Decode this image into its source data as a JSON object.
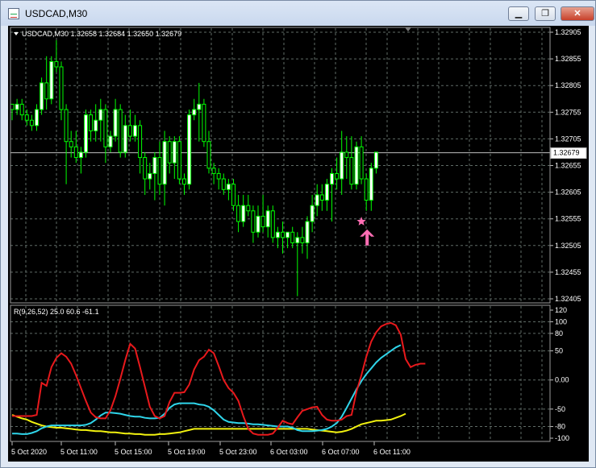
{
  "window": {
    "title": "USDCAD,M30",
    "minimize_glyph": "▁",
    "restore_glyph": "❐",
    "close_glyph": "✕"
  },
  "colors": {
    "background": "#000000",
    "grid": "#5f6b66",
    "candle": "#00ff00",
    "candle_bull_fill": "#ffffff",
    "price_line": "#c0c0c0",
    "red": "#e8191c",
    "cyan": "#2fd5ea",
    "yellow": "#f2f20f",
    "arrow": "#ff6eb4"
  },
  "main_chart": {
    "header": "USDCAD,M30  1.32658 1.32684 1.32650 1.32679",
    "price_ticks": [
      "1.32905",
      "1.32855",
      "1.32805",
      "1.32755",
      "1.32705",
      "1.32655",
      "1.32605",
      "1.32555",
      "1.32505",
      "1.32455",
      "1.32405"
    ],
    "current_price": "1.32679",
    "candles": [
      [
        1.3277,
        1.3277,
        1.3274,
        1.3276
      ],
      [
        1.3276,
        1.3278,
        1.3275,
        1.3277
      ],
      [
        1.3277,
        1.3278,
        1.3274,
        1.3275
      ],
      [
        1.3275,
        1.3276,
        1.3273,
        1.3274
      ],
      [
        1.3274,
        1.3275,
        1.3272,
        1.3273
      ],
      [
        1.3273,
        1.3277,
        1.3272,
        1.3276
      ],
      [
        1.3276,
        1.3282,
        1.3275,
        1.3281
      ],
      [
        1.3281,
        1.3286,
        1.3276,
        1.3278
      ],
      [
        1.3278,
        1.3286,
        1.3277,
        1.3285
      ],
      [
        1.3285,
        1.3289,
        1.3283,
        1.3284
      ],
      [
        1.3284,
        1.3285,
        1.3274,
        1.3276
      ],
      [
        1.3276,
        1.3277,
        1.3262,
        1.327
      ],
      [
        1.327,
        1.3272,
        1.3267,
        1.3269
      ],
      [
        1.3269,
        1.3272,
        1.3266,
        1.3267
      ],
      [
        1.3267,
        1.3269,
        1.3264,
        1.3268
      ],
      [
        1.3268,
        1.3276,
        1.3267,
        1.3275
      ],
      [
        1.3275,
        1.3276,
        1.327,
        1.3272
      ],
      [
        1.3272,
        1.3277,
        1.327,
        1.3274
      ],
      [
        1.3274,
        1.3278,
        1.327,
        1.3276
      ],
      [
        1.3276,
        1.3277,
        1.3266,
        1.3269
      ],
      [
        1.3269,
        1.3272,
        1.3268,
        1.3271
      ],
      [
        1.3271,
        1.3278,
        1.327,
        1.3276
      ],
      [
        1.3276,
        1.3277,
        1.3267,
        1.3268
      ],
      [
        1.3268,
        1.3275,
        1.3267,
        1.3273
      ],
      [
        1.3273,
        1.3276,
        1.327,
        1.3271
      ],
      [
        1.3271,
        1.3275,
        1.327,
        1.3273
      ],
      [
        1.3273,
        1.3274,
        1.3264,
        1.3267
      ],
      [
        1.3267,
        1.3268,
        1.326,
        1.3263
      ],
      [
        1.3263,
        1.3266,
        1.3261,
        1.3264
      ],
      [
        1.3264,
        1.3268,
        1.3259,
        1.3267
      ],
      [
        1.3267,
        1.327,
        1.326,
        1.3262
      ],
      [
        1.3262,
        1.3272,
        1.3258,
        1.327
      ],
      [
        1.327,
        1.3271,
        1.3264,
        1.3266
      ],
      [
        1.3266,
        1.3271,
        1.3263,
        1.327
      ],
      [
        1.327,
        1.3271,
        1.3262,
        1.3263
      ],
      [
        1.3263,
        1.3264,
        1.326,
        1.3262
      ],
      [
        1.3262,
        1.3276,
        1.3261,
        1.3275
      ],
      [
        1.3275,
        1.3278,
        1.3274,
        1.3276
      ],
      [
        1.3276,
        1.3281,
        1.327,
        1.3277
      ],
      [
        1.3277,
        1.3278,
        1.3269,
        1.327
      ],
      [
        1.327,
        1.3272,
        1.3264,
        1.3265
      ],
      [
        1.3265,
        1.3266,
        1.3262,
        1.3264
      ],
      [
        1.3264,
        1.3265,
        1.3261,
        1.3263
      ],
      [
        1.3263,
        1.3264,
        1.326,
        1.3261
      ],
      [
        1.3261,
        1.3263,
        1.3259,
        1.3262
      ],
      [
        1.3262,
        1.3263,
        1.3257,
        1.3258
      ],
      [
        1.3258,
        1.326,
        1.3253,
        1.3255
      ],
      [
        1.3255,
        1.326,
        1.3254,
        1.3258
      ],
      [
        1.3258,
        1.326,
        1.3256,
        1.3257
      ],
      [
        1.3257,
        1.3258,
        1.3251,
        1.3253
      ],
      [
        1.3253,
        1.3258,
        1.3252,
        1.3256
      ],
      [
        1.3256,
        1.326,
        1.3253,
        1.3254
      ],
      [
        1.3254,
        1.3258,
        1.3252,
        1.3257
      ],
      [
        1.3257,
        1.3258,
        1.3251,
        1.3252
      ],
      [
        1.3252,
        1.3254,
        1.325,
        1.3253
      ],
      [
        1.3253,
        1.3255,
        1.3249,
        1.3252
      ],
      [
        1.3252,
        1.3253,
        1.325,
        1.3253
      ],
      [
        1.3253,
        1.3254,
        1.325,
        1.3251
      ],
      [
        1.3251,
        1.3253,
        1.3241,
        1.3252
      ],
      [
        1.3252,
        1.3254,
        1.3249,
        1.3251
      ],
      [
        1.3251,
        1.3256,
        1.3248,
        1.3255
      ],
      [
        1.3255,
        1.326,
        1.3253,
        1.3258
      ],
      [
        1.3258,
        1.3262,
        1.3256,
        1.326
      ],
      [
        1.326,
        1.3262,
        1.3257,
        1.3259
      ],
      [
        1.3259,
        1.3263,
        1.3257,
        1.3262
      ],
      [
        1.3262,
        1.3265,
        1.3255,
        1.3264
      ],
      [
        1.3264,
        1.3267,
        1.3261,
        1.3263
      ],
      [
        1.3263,
        1.3272,
        1.326,
        1.3268
      ],
      [
        1.3268,
        1.3271,
        1.3263,
        1.3267
      ],
      [
        1.3267,
        1.3271,
        1.3261,
        1.3262
      ],
      [
        1.3262,
        1.327,
        1.3261,
        1.3269
      ],
      [
        1.3269,
        1.3271,
        1.3262,
        1.3263
      ],
      [
        1.3263,
        1.3264,
        1.3257,
        1.3259
      ],
      [
        1.3259,
        1.3266,
        1.3257,
        1.3265
      ],
      [
        1.3265,
        1.3268,
        1.3264,
        1.3268
      ]
    ],
    "signal_star": {
      "index": 71,
      "price": 1.3255
    },
    "signal_arrow": {
      "index": 72,
      "price": 1.32505
    }
  },
  "indicator": {
    "label": "R(9,26,52) 25.0 60.6 -61.1",
    "ticks": [
      "120",
      "100",
      "80",
      "50",
      "0.00",
      "-50",
      "-80",
      "-100"
    ],
    "red": [
      -62,
      -62,
      -62,
      -62,
      -62,
      -60,
      -5,
      -10,
      22,
      38,
      46,
      40,
      28,
      8,
      -14,
      -36,
      -56,
      -64,
      -66,
      -66,
      -52,
      -28,
      2,
      34,
      62,
      54,
      22,
      -12,
      -46,
      -62,
      -66,
      -62,
      -38,
      -22,
      -22,
      -21,
      -8,
      18,
      34,
      40,
      52,
      46,
      24,
      0,
      -14,
      -22,
      -36,
      -62,
      -84,
      -92,
      -94,
      -94,
      -94,
      -92,
      -82,
      -70,
      -74,
      -76,
      -64,
      -53,
      -50,
      -47,
      -46,
      -60,
      -68,
      -70,
      -70,
      -68,
      -62,
      -60,
      -20,
      8,
      40,
      66,
      82,
      92,
      96,
      98,
      94,
      78,
      36,
      22,
      26,
      28,
      28
    ],
    "cyan": [
      -92,
      -92,
      -93,
      -93,
      -91,
      -88,
      -83,
      -80,
      -78,
      -78,
      -78,
      -78,
      -78,
      -78,
      -78,
      -77,
      -74,
      -68,
      -61,
      -56,
      -56,
      -57,
      -58,
      -60,
      -62,
      -63,
      -63,
      -65,
      -66,
      -66,
      -65,
      -58,
      -48,
      -42,
      -40,
      -40,
      -40,
      -40,
      -42,
      -43,
      -46,
      -52,
      -60,
      -68,
      -72,
      -73,
      -74,
      -74,
      -75,
      -76,
      -76,
      -77,
      -78,
      -79,
      -80,
      -80,
      -80,
      -82,
      -86,
      -88,
      -88,
      -88,
      -87,
      -86,
      -84,
      -80,
      -74,
      -63,
      -48,
      -32,
      -16,
      -2,
      10,
      20,
      30,
      38,
      44,
      50,
      56,
      60
    ],
    "yellow": [
      -60,
      -63,
      -66,
      -68,
      -72,
      -75,
      -78,
      -80,
      -81,
      -82,
      -82,
      -83,
      -84,
      -85,
      -86,
      -86,
      -87,
      -88,
      -88,
      -89,
      -90,
      -90,
      -91,
      -92,
      -92,
      -93,
      -93,
      -94,
      -94,
      -94,
      -93,
      -93,
      -92,
      -91,
      -90,
      -88,
      -86,
      -84,
      -84,
      -84,
      -84,
      -84,
      -84,
      -84,
      -84,
      -84,
      -84,
      -84,
      -84,
      -84,
      -84,
      -84,
      -84,
      -84,
      -84,
      -84,
      -84,
      -84,
      -84,
      -84,
      -84,
      -85,
      -86,
      -87,
      -88,
      -89,
      -90,
      -89,
      -87,
      -84,
      -80,
      -76,
      -74,
      -72,
      -70,
      -70,
      -69,
      -68,
      -65,
      -62,
      -58
    ]
  },
  "time_axis": [
    "5 Oct 2020",
    "5 Oct 11:00",
    "5 Oct 15:00",
    "5 Oct 19:00",
    "5 Oct 23:00",
    "6 Oct 03:00",
    "6 Oct 07:00",
    "6 Oct 11:00"
  ]
}
